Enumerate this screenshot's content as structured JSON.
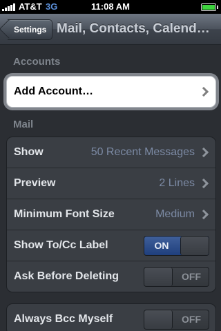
{
  "status_bar": {
    "carrier": "AT&T",
    "network": "3G",
    "time": "11:08 AM",
    "icons": [
      "signal-bars-icon",
      "battery-icon"
    ]
  },
  "nav_bar": {
    "back_label": "Settings",
    "title": "Mail, Contacts, Calend…"
  },
  "accounts_section": {
    "header": "Accounts",
    "add_account_label": "Add Account…"
  },
  "mail_section": {
    "header": "Mail",
    "rows": [
      {
        "label": "Show",
        "value": "50 Recent Messages"
      },
      {
        "label": "Preview",
        "value": "2 Lines"
      },
      {
        "label": "Minimum Font Size",
        "value": "Medium"
      }
    ],
    "toggles": [
      {
        "label": "Show To/Cc Label",
        "state": "ON"
      },
      {
        "label": "Ask Before Deleting",
        "state": "OFF"
      }
    ]
  },
  "bcc_section": {
    "label": "Always Bcc Myself",
    "state": "OFF"
  },
  "colors": {
    "background": "#2b2e33",
    "switch_on": "#2f4f8f",
    "value_text": "#7c8aa4"
  }
}
